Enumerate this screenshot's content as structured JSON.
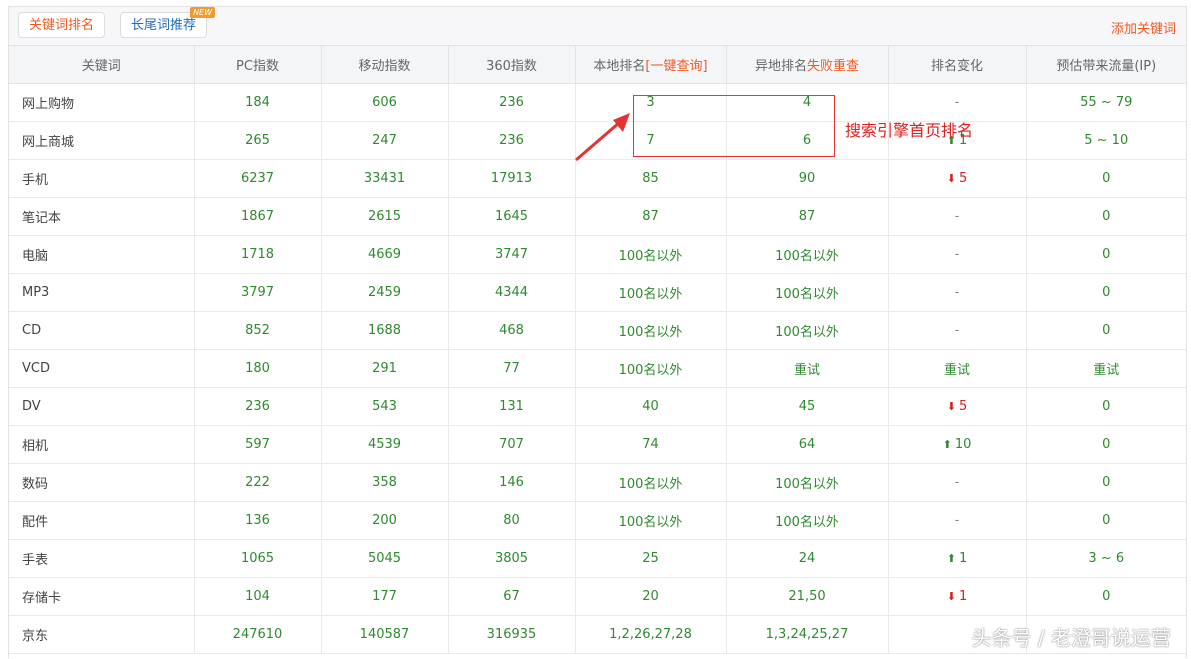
{
  "topbar": {
    "tab_active": "关键词排名",
    "tab_second": "长尾词推荐",
    "new_badge": "NEW",
    "add_keyword": "添加关键词"
  },
  "table": {
    "headers": {
      "keyword": "关键词",
      "pc": "PC指数",
      "mobile": "移动指数",
      "idx360": "360指数",
      "local_prefix": "本地排名",
      "local_link": "[一键查询]",
      "remote_prefix": "异地排名",
      "remote_link": "失败重查",
      "change": "排名变化",
      "traffic": "预估带来流量(IP)"
    },
    "rows": [
      {
        "kw": "网上购物",
        "pc": "184",
        "mobile": "606",
        "i360": "236",
        "local": "3",
        "remote": "4",
        "change": "-",
        "dir": "none",
        "traffic": "55 ~ 79"
      },
      {
        "kw": "网上商城",
        "pc": "265",
        "mobile": "247",
        "i360": "236",
        "local": "7",
        "remote": "6",
        "change": "1",
        "dir": "up",
        "traffic": "5 ~ 10"
      },
      {
        "kw": "手机",
        "pc": "6237",
        "mobile": "33431",
        "i360": "17913",
        "local": "85",
        "remote": "90",
        "change": "5",
        "dir": "down",
        "traffic": "0"
      },
      {
        "kw": "笔记本",
        "pc": "1867",
        "mobile": "2615",
        "i360": "1645",
        "local": "87",
        "remote": "87",
        "change": "-",
        "dir": "none",
        "traffic": "0"
      },
      {
        "kw": "电脑",
        "pc": "1718",
        "mobile": "4669",
        "i360": "3747",
        "local": "100名以外",
        "remote": "100名以外",
        "change": "-",
        "dir": "none",
        "traffic": "0"
      },
      {
        "kw": "MP3",
        "pc": "3797",
        "mobile": "2459",
        "i360": "4344",
        "local": "100名以外",
        "remote": "100名以外",
        "change": "-",
        "dir": "none",
        "traffic": "0"
      },
      {
        "kw": "CD",
        "pc": "852",
        "mobile": "1688",
        "i360": "468",
        "local": "100名以外",
        "remote": "100名以外",
        "change": "-",
        "dir": "none",
        "traffic": "0"
      },
      {
        "kw": "VCD",
        "pc": "180",
        "mobile": "291",
        "i360": "77",
        "local": "100名以外",
        "remote": "重试",
        "change": "重试",
        "dir": "text",
        "traffic": "重试"
      },
      {
        "kw": "DV",
        "pc": "236",
        "mobile": "543",
        "i360": "131",
        "local": "40",
        "remote": "45",
        "change": "5",
        "dir": "down",
        "traffic": "0"
      },
      {
        "kw": "相机",
        "pc": "597",
        "mobile": "4539",
        "i360": "707",
        "local": "74",
        "remote": "64",
        "change": "10",
        "dir": "up",
        "traffic": "0"
      },
      {
        "kw": "数码",
        "pc": "222",
        "mobile": "358",
        "i360": "146",
        "local": "100名以外",
        "remote": "100名以外",
        "change": "-",
        "dir": "none",
        "traffic": "0"
      },
      {
        "kw": "配件",
        "pc": "136",
        "mobile": "200",
        "i360": "80",
        "local": "100名以外",
        "remote": "100名以外",
        "change": "-",
        "dir": "none",
        "traffic": "0"
      },
      {
        "kw": "手表",
        "pc": "1065",
        "mobile": "5045",
        "i360": "3805",
        "local": "25",
        "remote": "24",
        "change": "1",
        "dir": "up",
        "traffic": "3 ~ 6"
      },
      {
        "kw": "存储卡",
        "pc": "104",
        "mobile": "177",
        "i360": "67",
        "local": "20",
        "remote": "21,50",
        "change": "1",
        "dir": "down",
        "traffic": "0"
      },
      {
        "kw": "京东",
        "pc": "247610",
        "mobile": "140587",
        "i360": "316935",
        "local": "1,2,26,27,28",
        "remote": "1,3,24,25,27",
        "change": "",
        "dir": "none",
        "traffic": ""
      }
    ]
  },
  "annotation": {
    "text": "搜索引擎首页排名"
  },
  "watermark": {
    "text": "头条号 / 老澄哥说运营"
  },
  "colors": {
    "accent_orange": "#ef5a23",
    "value_green": "#2f8a2f",
    "down_red": "#d42020",
    "annot_red": "#e33333"
  },
  "icons": {
    "up": "green-up-arrow-icon",
    "down": "red-down-arrow-icon"
  }
}
